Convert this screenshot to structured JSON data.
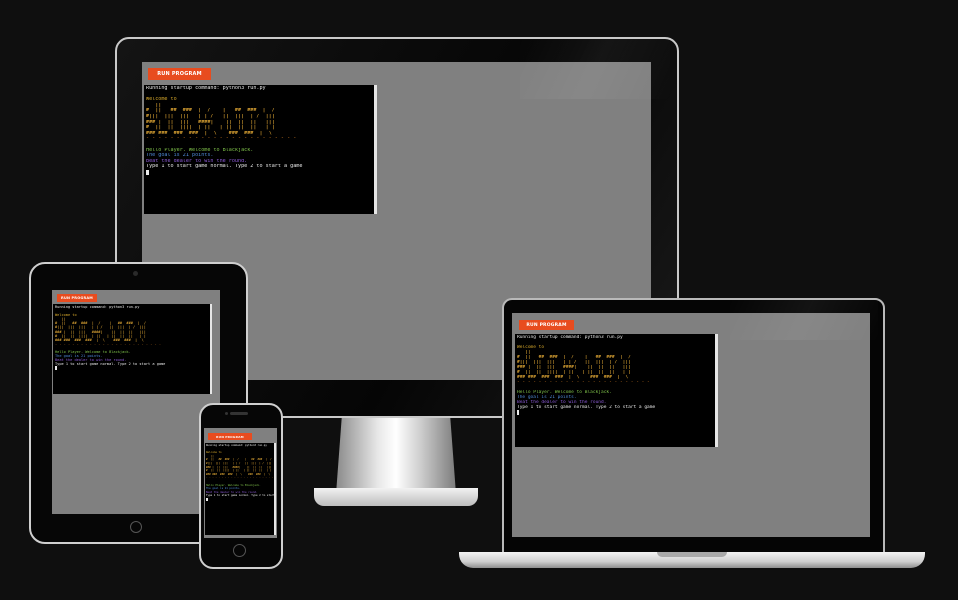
{
  "app": {
    "run_button_label": "Run Program"
  },
  "terminal": {
    "startup_line": "Running startup command: python3 run.py",
    "welcome_line": "Welcome to",
    "pre_art_line": "   ||  ",
    "art_lines": [
      "#  ||   ##  ###  |  /    |   ##  ###  |  /",
      "#|||  |||  |||   | | /   ||  |||  | /  |||",
      "### |  ||  |||   ####|    ||  ||  ||   |||",
      "#  ||  ||  ||||  | ||   | ||  ||  ||   | |",
      "### ###  ###  ###  |  \\    ###  ###  |  \\"
    ],
    "dashes": "- - - - - - - - - - - - - - - - - - - - - - - - -",
    "hello_line": "Hello Player. Welcome to Blackjack.",
    "goal_line": "The goal is 21 points.",
    "rules_line": "Beat the dealer to win the round.",
    "prompt_line": "Type 1 to start game normal. Type 2 to start a game"
  },
  "icons": {
    "cursor": "cursor-block-icon"
  },
  "colors": {
    "accent": "#e84c1f",
    "screen_bg": "#808080",
    "terminal_bg": "#000000"
  }
}
